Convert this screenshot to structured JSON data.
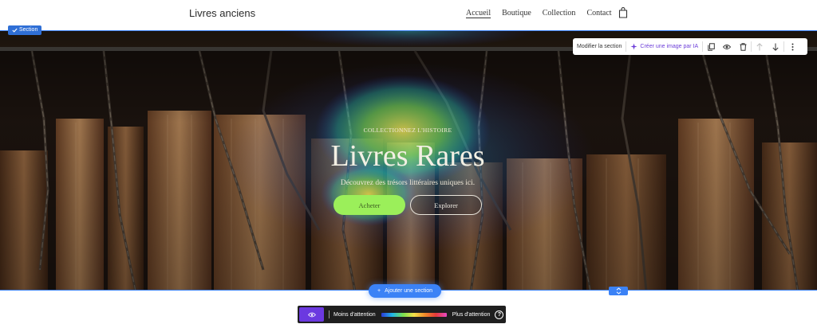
{
  "nav": {
    "brand": "Livres anciens",
    "links": [
      "Accueil",
      "Boutique",
      "Collection",
      "Contact"
    ]
  },
  "hero": {
    "section_tag": "Section",
    "eyebrow": "COLLECTIONNEZ L'HISTOIRE",
    "title": "Livres Rares",
    "subtitle": "Découvrez des trésors littéraires uniques ici.",
    "buy_button": "Acheter",
    "explore_button": "Explorer"
  },
  "toolbar": {
    "edit_label": "Modifier la section",
    "ai_label": "Créer une image par IA"
  },
  "editor": {
    "add_section": "Ajouter une section"
  },
  "attention": {
    "less_label": "Moins d'attention",
    "more_label": "Plus d'attention"
  },
  "colors": {
    "accent": "#3b82f6",
    "button_primary": "#9bef5a",
    "ai_purple": "#6d3fd9"
  }
}
